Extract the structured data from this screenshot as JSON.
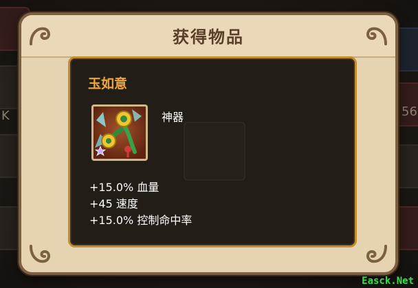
{
  "dialog": {
    "title": "获得物品"
  },
  "item": {
    "name": "玉如意",
    "type": "神器",
    "stats": [
      "+15.0% 血量",
      "+45 速度",
      "+15.0% 控制命中率"
    ],
    "icon": "jade-ruyi-icon"
  },
  "background": {
    "side_labels": [
      "K",
      "56"
    ]
  },
  "watermark": "Easck.Net",
  "colors": {
    "panel": "#e6d3b2",
    "content_bg": "#231d18",
    "content_border": "#c28f2f",
    "item_name": "#f2a63a",
    "title": "#5a3f28"
  }
}
